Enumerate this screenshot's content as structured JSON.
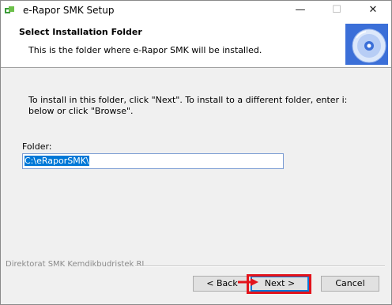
{
  "window": {
    "title": "e-Rapor SMK Setup",
    "controls": {
      "minimize": "—",
      "maximize": "☐",
      "close": "✕"
    }
  },
  "header": {
    "title": "Select Installation Folder",
    "subtitle": "This is the folder where e-Rapor SMK will be installed."
  },
  "body": {
    "instruction": "To install in this folder, click \"Next\". To install to a different folder, enter i: below or click \"Browse\".",
    "folder_label": "Folder:",
    "folder_value": "C:\\eRaporSMK\\"
  },
  "footer": {
    "brand": "Direktorat SMK Kemdikbudristek RI",
    "back_label": "< Back",
    "next_label": "Next >",
    "cancel_label": "Cancel"
  },
  "annotations": {
    "highlight_color": "#e3131b",
    "arrow_icon": "red-arrow-icon"
  }
}
